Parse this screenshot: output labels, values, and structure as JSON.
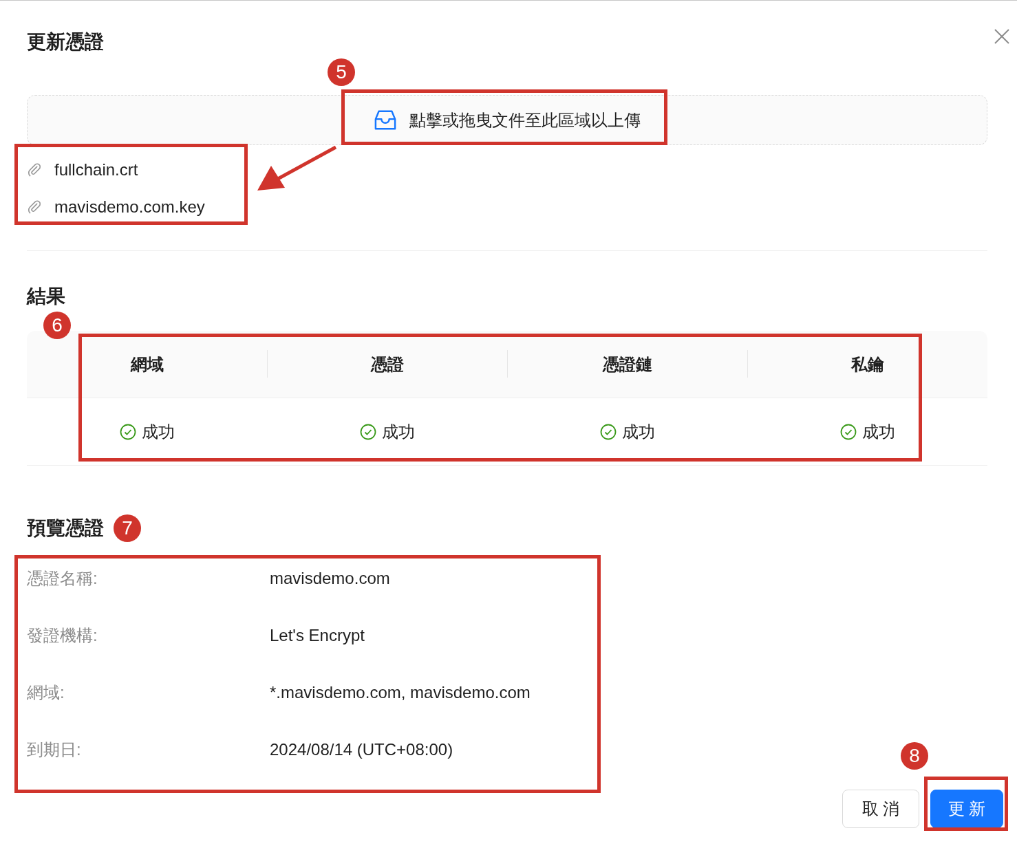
{
  "dialog": {
    "title": "更新憑證"
  },
  "upload": {
    "hint": "點擊或拖曳文件至此區域以上傳",
    "files": [
      "fullchain.crt",
      "mavisdemo.com.key"
    ]
  },
  "result": {
    "heading": "結果",
    "columns": [
      "網域",
      "憑證",
      "憑證鏈",
      "私鑰"
    ],
    "cells": [
      {
        "text": "成功",
        "success": true
      },
      {
        "text": "成功",
        "success": true
      },
      {
        "text": "成功",
        "success": true
      },
      {
        "text": "成功",
        "success": true
      }
    ]
  },
  "preview": {
    "heading": "預覽憑證",
    "fields": [
      {
        "label": "憑證名稱:",
        "value": "mavisdemo.com"
      },
      {
        "label": "發證機構:",
        "value": "Let's Encrypt"
      },
      {
        "label": "網域:",
        "value": "*.mavisdemo.com, mavisdemo.com"
      },
      {
        "label": "到期日:",
        "value": "2024/08/14 (UTC+08:00)"
      }
    ]
  },
  "footer": {
    "buttons": [
      {
        "label": "取 消",
        "kind": "default"
      },
      {
        "label": "更 新",
        "kind": "primary"
      }
    ]
  },
  "annotations": [
    "5",
    "6",
    "7",
    "8"
  ]
}
